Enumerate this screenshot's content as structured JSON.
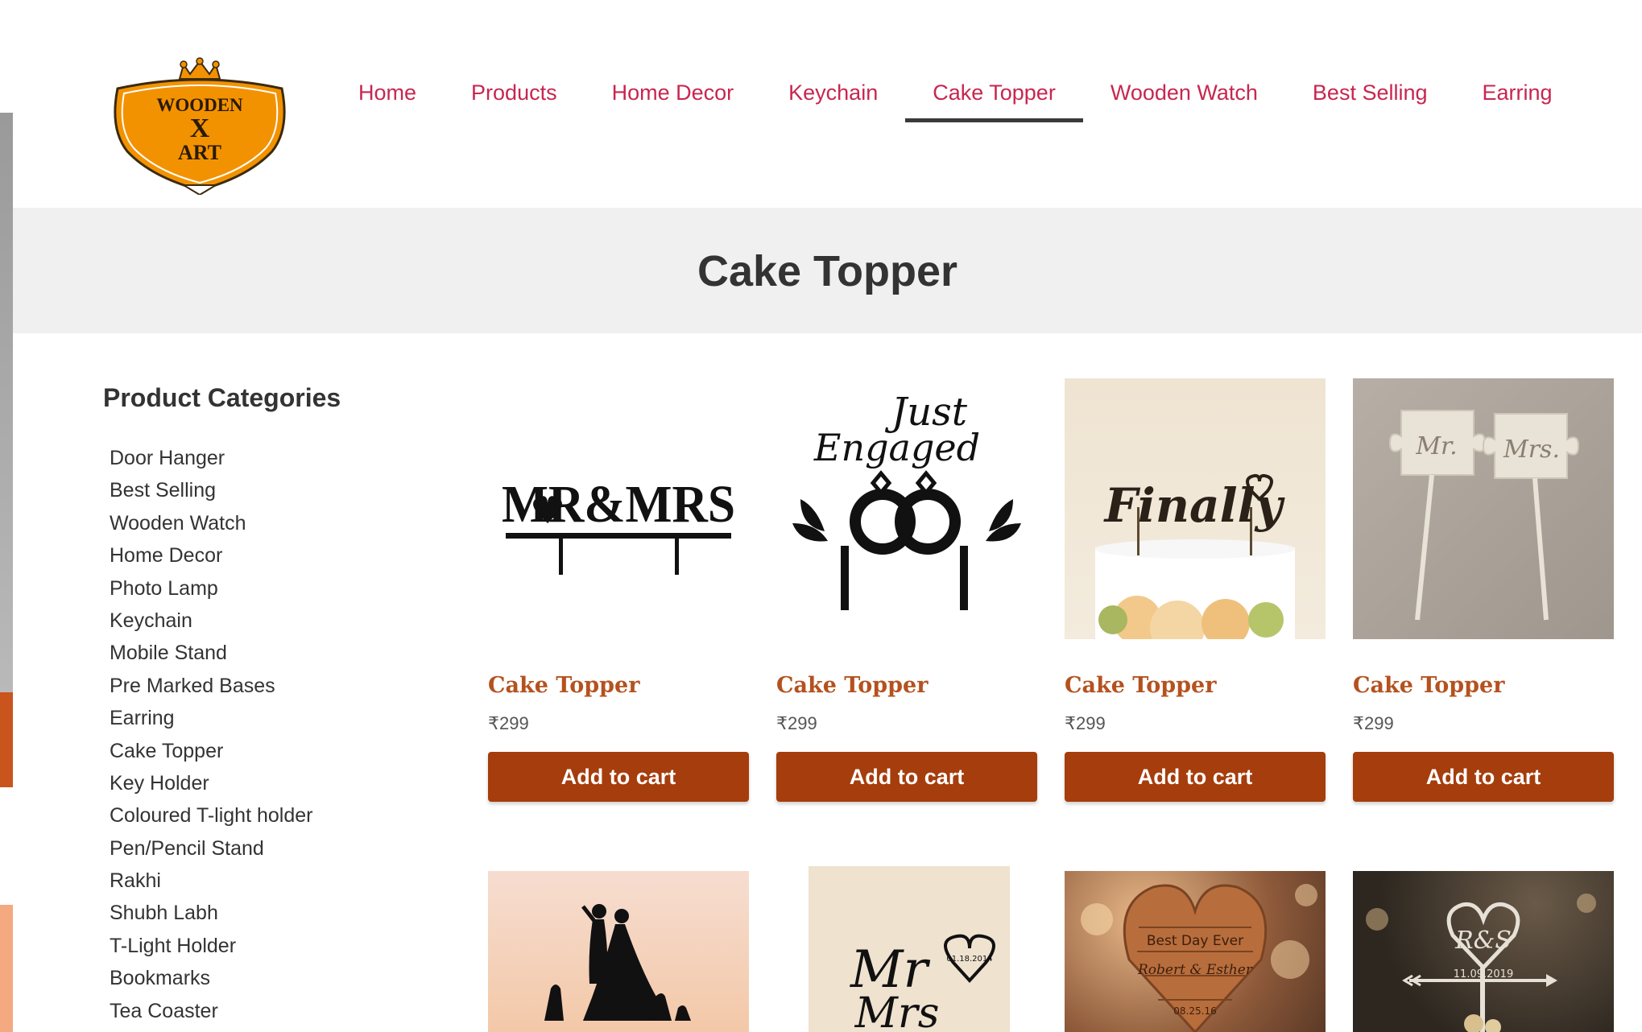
{
  "brand": {
    "logo_line1": "WOODEN",
    "logo_line2": "X",
    "logo_line3": "ART",
    "logo_color": "#f39200"
  },
  "nav": {
    "items": [
      {
        "label": "Home"
      },
      {
        "label": "Products"
      },
      {
        "label": "Home Decor"
      },
      {
        "label": "Keychain"
      },
      {
        "label": "Cake Topper",
        "active": true
      },
      {
        "label": "Wooden Watch"
      },
      {
        "label": "Best Selling"
      },
      {
        "label": "Earring"
      }
    ],
    "link_color": "#c8264f"
  },
  "page": {
    "title": "Cake Topper"
  },
  "sidebar": {
    "title": "Product Categories",
    "categories": [
      "Door Hanger",
      "Best Selling",
      "Wooden Watch",
      "Home Decor",
      "Photo Lamp",
      "Keychain",
      "Mobile Stand",
      "Pre Marked Bases",
      "Earring",
      "Cake Topper",
      "Key Holder",
      "Coloured T-light holder",
      "Pen/Pencil Stand",
      "Rakhi",
      "Shubh Labh",
      "T-Light Holder",
      "Bookmarks",
      "Tea Coaster"
    ]
  },
  "products": [
    {
      "title": "Cake Topper",
      "price": "₹299",
      "button": "Add to cart",
      "image": {
        "text": "MR&MRS"
      }
    },
    {
      "title": "Cake Topper",
      "price": "₹299",
      "button": "Add to cart",
      "image": {
        "text1": "Just",
        "text2": "Engaged"
      }
    },
    {
      "title": "Cake Topper",
      "price": "₹299",
      "button": "Add to cart",
      "image": {
        "text": "Finally"
      }
    },
    {
      "title": "Cake Topper",
      "price": "₹299",
      "button": "Add to cart",
      "image": {
        "text1": "Mr.",
        "text2": "Mrs."
      }
    }
  ],
  "second_row_images": [
    {
      "text": ""
    },
    {
      "text1": "Mr",
      "text2": "Mrs",
      "date": "01.18.2014"
    },
    {
      "text1": "Best Day Ever",
      "text2": "Robert & Esther",
      "date": "08.25.16"
    },
    {
      "text1": "R&S",
      "date": "11.09.2019"
    }
  ],
  "colors": {
    "button_bg": "#a63d0c",
    "product_title": "#b4521f",
    "title_band": "#f0f0f0"
  }
}
